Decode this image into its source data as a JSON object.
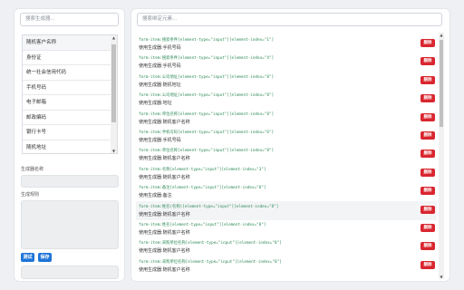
{
  "left": {
    "search_placeholder": "搜索生成器...",
    "generators": [
      "随机客户名称",
      "身份证",
      "统一社会信用代码",
      "手机号码",
      "电子邮箱",
      "邮政编码",
      "银行卡号",
      "随机地址"
    ],
    "name_label": "生成器名称",
    "rule_label": "生成规则",
    "test_button": "测试",
    "save_button": "保存"
  },
  "right": {
    "search_placeholder": "搜索绑定元素...",
    "delete_label": "删除",
    "rows": [
      {
        "code": "form-item:搜索条件[element-type=\"input\"][element-index=\"1\"]",
        "gen": "使用生成器:手机号码"
      },
      {
        "code": "form-item:搜索条件[element-type=\"input\"][element-index=\"4\"]",
        "gen": "使用生成器:手机号码"
      },
      {
        "code": "form-item:公司地址[element-type=\"input\"][element-index=\"8\"]",
        "gen": "使用生成器:随机地址"
      },
      {
        "code": "form-item:公司地址[element-type=\"input\"][element-index=\"8\"]",
        "gen": "使用生成器:地址"
      },
      {
        "code": "form-item:单位名称[element-type=\"input\"][element-index=\"8\"]",
        "gen": "使用生成器:随机客户名称"
      },
      {
        "code": "form-item:手机号码[element-type=\"input\"][element-index=\"6\"]",
        "gen": "使用生成器:手机号码"
      },
      {
        "code": "form-item:单位名称[element-type=\"input\"][element-index=\"8\"]",
        "gen": "使用生成器:随机客户名称"
      },
      {
        "code": "form-item:名称[element-type=\"input\"][element-index=\"3\"]",
        "gen": "使用生成器:随机客户名称"
      },
      {
        "code": "form-item:备注[element-type=\"input\"][element-index=\"8\"]",
        "gen": "使用生成器:备注"
      },
      {
        "code": "form-item:姓名(名称)[element-type=\"input\"][element-index=\"8\"]",
        "gen": "使用生成器:随机客户名称"
      },
      {
        "code": "form-item:姓名[element-type=\"input\"][element-index=\"8\"]",
        "gen": "使用生成器:随机客户名称"
      },
      {
        "code": "form-item:采购单位名称[element-type=\"input\"][element-index=\"8\"]",
        "gen": "使用生成器:随机客户名称"
      },
      {
        "code": "form-item:采购单位名称[element-type=\"input\"][element-index=\"8\"]",
        "gen": "使用生成器:随机客户名称"
      }
    ]
  },
  "colors": {
    "accent": "#1e74d8",
    "danger": "#d9262f",
    "code": "#2e8b57"
  }
}
